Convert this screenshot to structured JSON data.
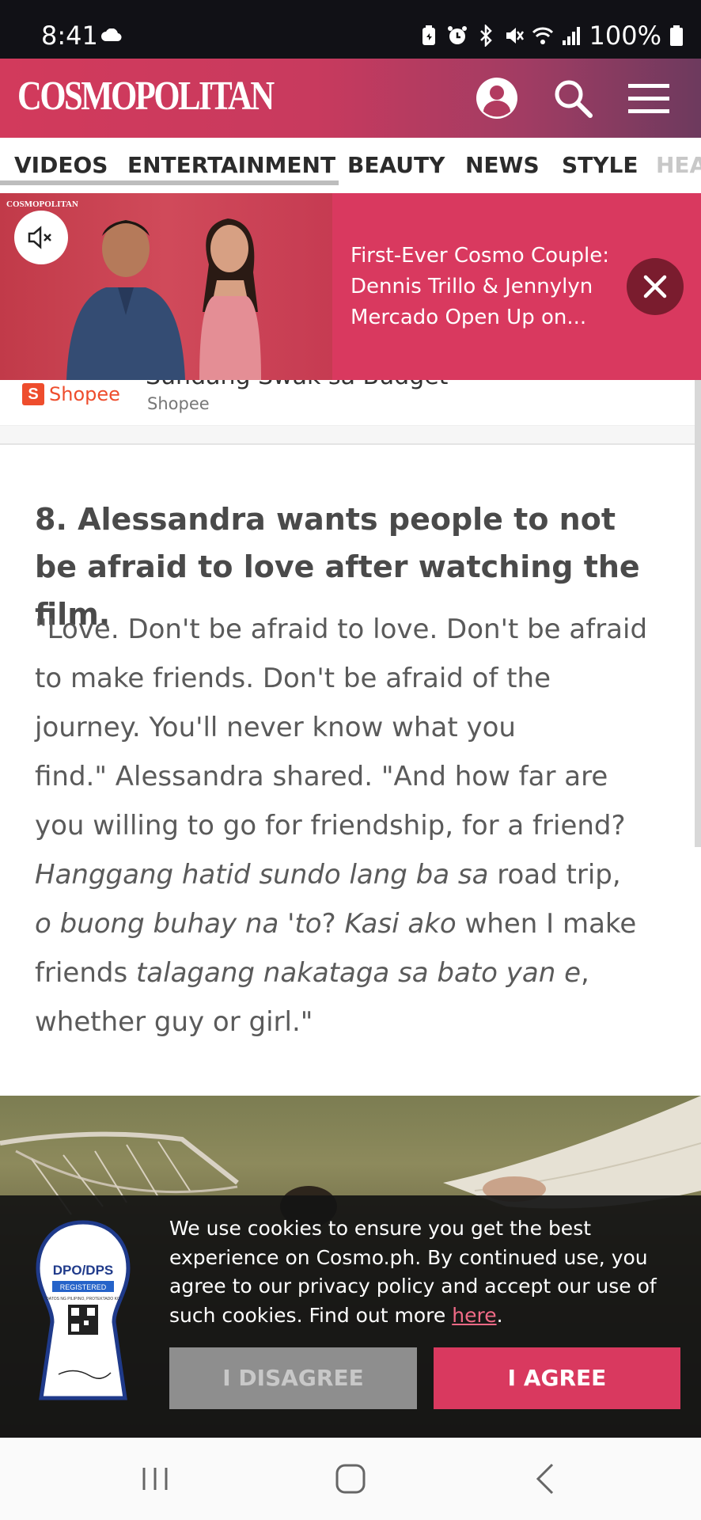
{
  "status_bar": {
    "time": "8:41",
    "battery": "100%",
    "icons": [
      "cloud-icon",
      "battery-saver-icon",
      "alarm-icon",
      "bluetooth-icon",
      "mute-icon",
      "wifi-icon",
      "signal-icon",
      "battery-icon"
    ]
  },
  "header": {
    "logo": "COSMOPOLITAN",
    "brand_color": "#d23a5c"
  },
  "categories": [
    "VIDEOS",
    "ENTERTAINMENT",
    "BEAUTY",
    "NEWS",
    "STYLE",
    "HEA"
  ],
  "video": {
    "thumbnail_brand": "COSMOPOLITAN",
    "title": "First-Ever Cosmo Couple: Dennis Trillo & Jennylyn Mercado Open Up on..."
  },
  "ad": {
    "cut_title": "Sundang Swak sa Budget",
    "brand": "Shopee",
    "source": "Shopee"
  },
  "article": {
    "headline": "8. Alessandra wants people to not be afraid to love after watching the film.",
    "body": {
      "l1": "\"Love. Don't be afraid to love. Don't be afraid",
      "l2": "to make friends. Don't be afraid of the",
      "l3": "journey. You'll never know what you",
      "l4": "find.\" Alessandra shared. \"And how far are",
      "l5": "you willing to go for friendship, for a friend?",
      "l6_italic": "Hanggang hatid sundo lang ba sa",
      "l6_normal": " road trip,",
      "l7_italic1": "o buong buhay na 'to",
      "l7_normal1": "? ",
      "l7_italic2": "Kasi ako",
      "l7_normal2": " when I make",
      "l8_normal1": "friends ",
      "l8_italic": "talagang nakataga sa bato yan e",
      "l8_normal2": ",",
      "l9": "whether guy or girl.\""
    }
  },
  "cookie": {
    "seal_title": "DPO/DPS",
    "seal_registered": "REGISTERED",
    "seal_motto": "\"DATOS NG PILIPINO, PROTEKTADO KO\"",
    "text": "We use cookies to ensure you get the best experience on Cosmo.ph. By continued use, you agree to our privacy policy and accept our use of such cookies. Find out more ",
    "link": "here",
    "period": ".",
    "disagree": "I DISAGREE",
    "agree": "I AGREE"
  }
}
